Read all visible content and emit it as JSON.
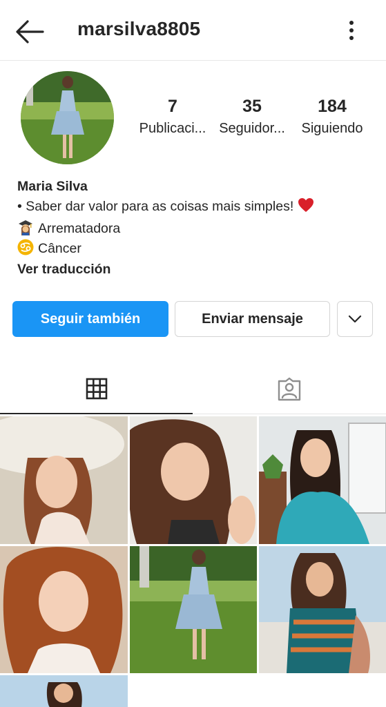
{
  "header": {
    "username": "marsilva8805",
    "back_icon": "arrow-left-icon",
    "more_icon": "more-vertical-icon"
  },
  "profile": {
    "stats": [
      {
        "value": "7",
        "label": "Publicaci..."
      },
      {
        "value": "35",
        "label": "Seguidor..."
      },
      {
        "value": "184",
        "label": "Siguiendo"
      }
    ],
    "name": "Maria Silva",
    "bio_line1": "• Saber dar valor para as coisas mais simples!",
    "bio_line2": "Arrematadora",
    "bio_line3": "Câncer",
    "translate": "Ver traducción"
  },
  "actions": {
    "follow": "Seguir también",
    "message": "Enviar mensaje"
  },
  "colors": {
    "accent": "#1a95f5",
    "heart": "#d9202a",
    "text": "#262626"
  },
  "tabs": [
    {
      "name": "grid",
      "icon": "grid-icon"
    },
    {
      "name": "tagged",
      "icon": "tagged-person-icon"
    }
  ],
  "grid": {
    "posts": [
      {
        "subject": "woman with sun hat"
      },
      {
        "subject": "woman smiling portrait"
      },
      {
        "subject": "woman in blue dress"
      },
      {
        "subject": "woman red hair portrait"
      },
      {
        "subject": "woman in dress on lawn"
      },
      {
        "subject": "woman at beach"
      },
      {
        "subject": "woman outdoors"
      }
    ]
  }
}
